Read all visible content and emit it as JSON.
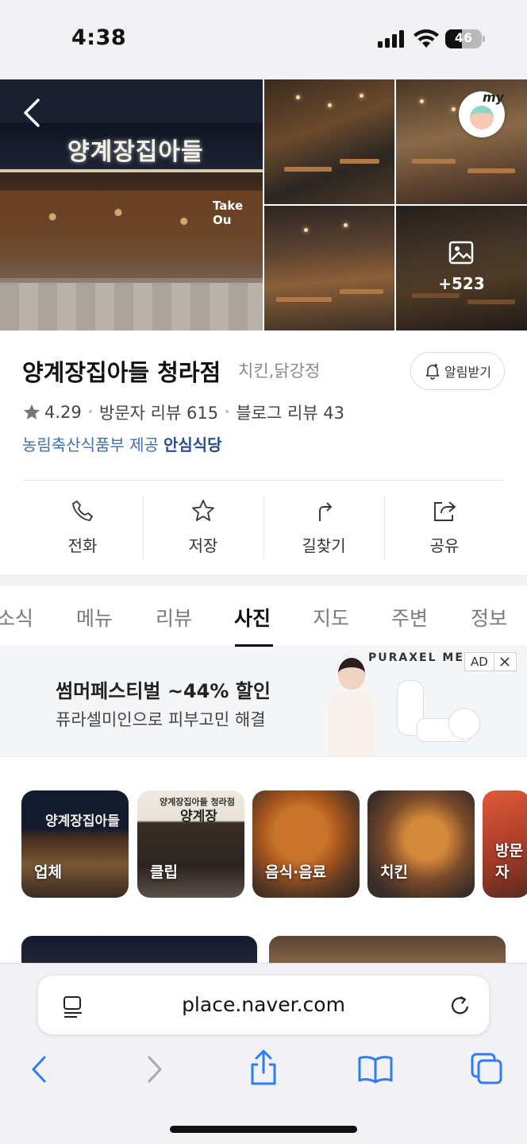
{
  "status_bar": {
    "time": "4:38",
    "battery": "46",
    "battery_level": 0.46
  },
  "photos": {
    "more_count": "+523",
    "sign_text": "양계장집아들",
    "takeout_text": "Take Ou"
  },
  "my_badge": {
    "label": "my"
  },
  "place": {
    "name": "양계장집아들 청라점",
    "category": "치킨,닭강정",
    "alarm_label": "알림받기",
    "rating": "4.29",
    "visitor_reviews": "방문자 리뷰 615",
    "blog_reviews": "블로그 리뷰 43",
    "gov_provider": "농림축산식품부 제공",
    "safe_label": "안심식당"
  },
  "actions": [
    {
      "label": "전화",
      "icon": "phone-icon"
    },
    {
      "label": "저장",
      "icon": "star-icon"
    },
    {
      "label": "길찾기",
      "icon": "directions-icon"
    },
    {
      "label": "공유",
      "icon": "share-icon"
    }
  ],
  "tabs": [
    "소식",
    "메뉴",
    "리뷰",
    "사진",
    "지도",
    "주변",
    "정보"
  ],
  "active_tab": "사진",
  "ad": {
    "title": "썸머페스티벌 ~44% 할인",
    "subtitle": "퓨라셀미인으로 피부고민 해결",
    "brand": "PURAXEL ME",
    "badge": "AD"
  },
  "categories": [
    {
      "label": "업체",
      "sign": "양계장집아들"
    },
    {
      "label": "클립",
      "sign": "양계장",
      "top": "양계장집아들 청라점"
    },
    {
      "label": "음식·음료"
    },
    {
      "label": "치킨"
    },
    {
      "label": "방문자"
    }
  ],
  "browser": {
    "url": "place.naver.com"
  },
  "colors": {
    "link_blue": "#3d6fb0",
    "safe_navy": "#2a4d8c",
    "ios_blue": "#2f7cf6"
  }
}
